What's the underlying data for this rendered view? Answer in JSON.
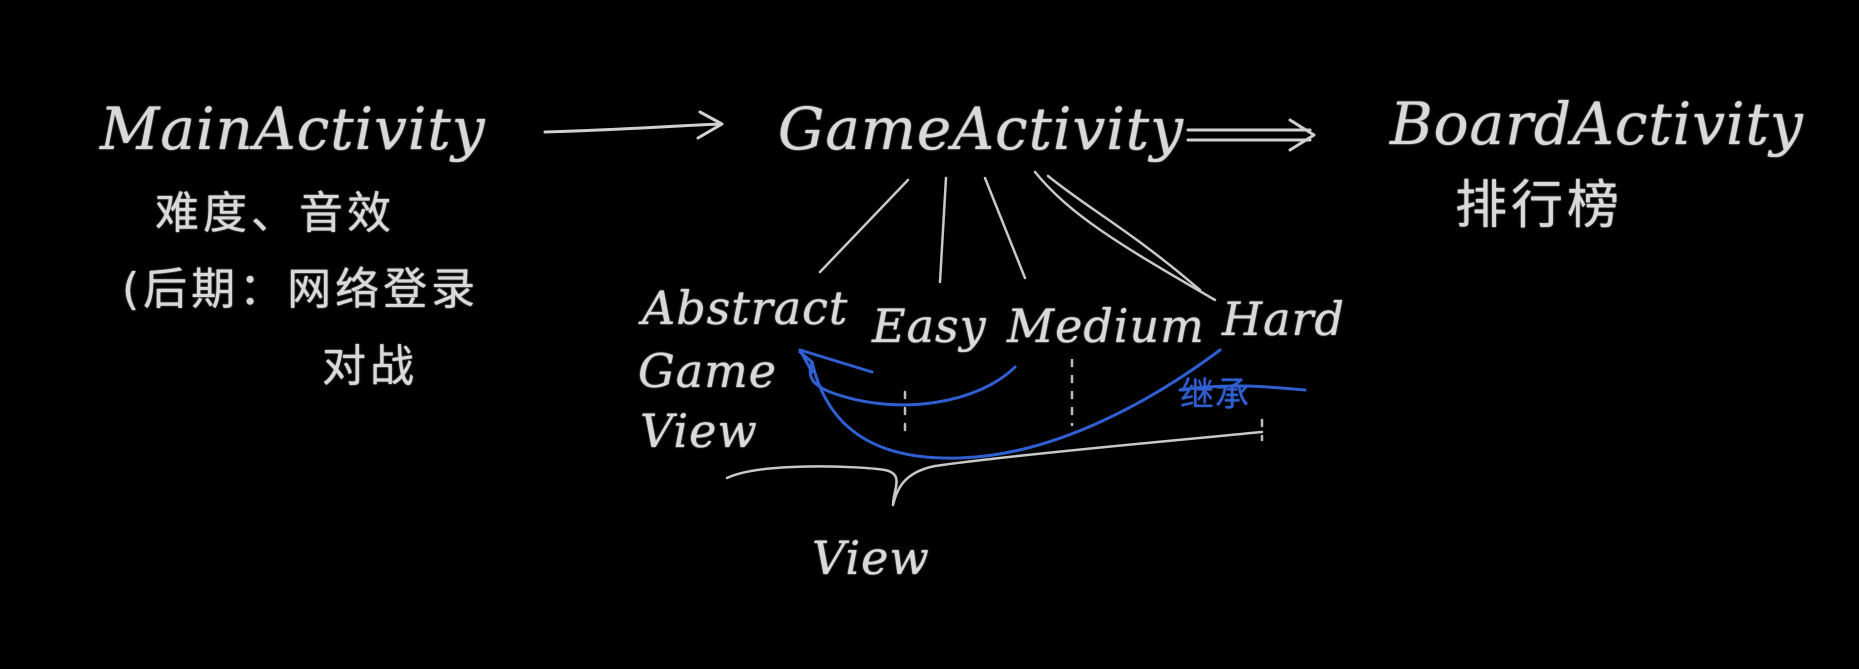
{
  "nodes": {
    "main_activity": "MainActivity",
    "main_note_1": "难度、音效",
    "main_note_2": "(后期：网络登录",
    "main_note_3": "对战",
    "game_activity": "GameActivity",
    "board_activity": "BoardActivity",
    "board_note": "排行榜",
    "abstract_line1": "Abstract",
    "abstract_line2": "Game",
    "abstract_line3": "View",
    "easy": "Easy",
    "medium": "Medium",
    "hard": "Hard",
    "inherit_note": "继承",
    "view": "View"
  },
  "colors": {
    "background": "#000000",
    "chalk_white": "#d9d9d9",
    "chalk_blue": "#2f5fd0"
  }
}
